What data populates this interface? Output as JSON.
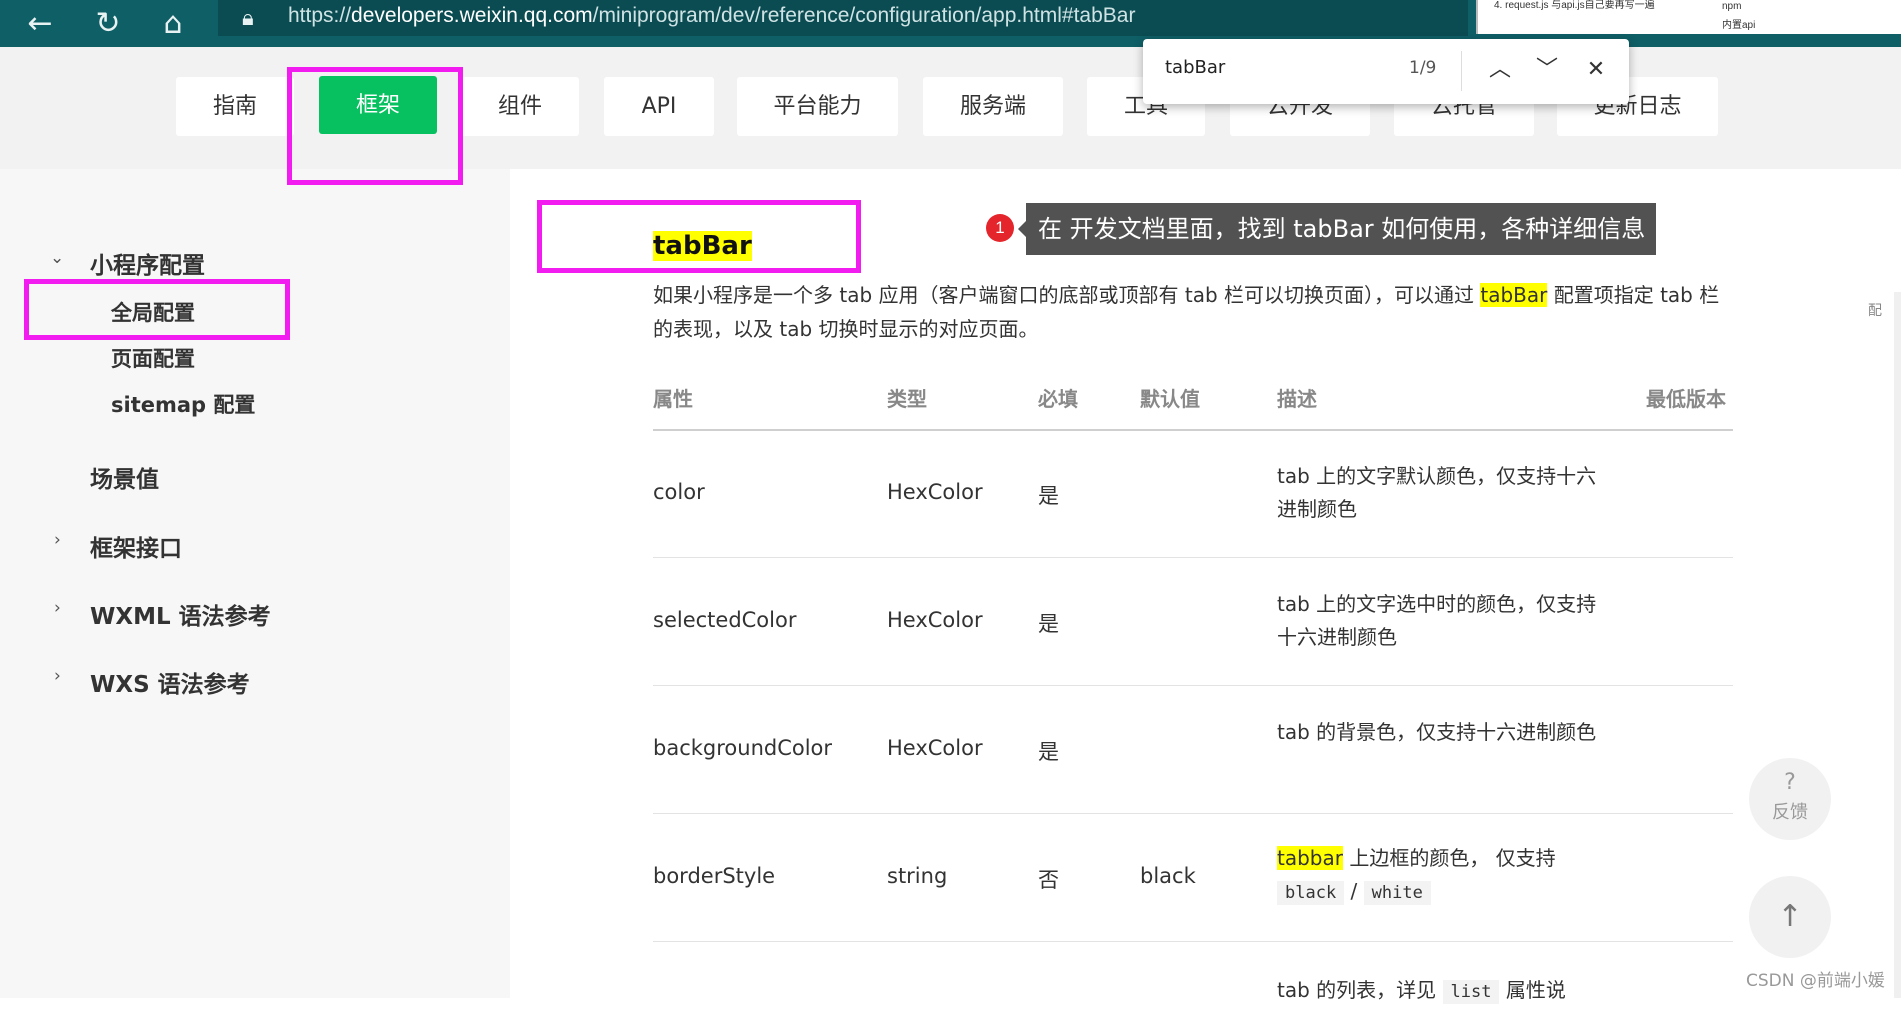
{
  "browser": {
    "url_prefix": "https://",
    "url_domain": "developers.weixin.qq.com",
    "url_path": "/miniprogram/dev/reference/configuration/app.html#tabBar",
    "thumb_line1": "4. request.js 与api.js自己要再写一遍",
    "thumb_line2": "npm",
    "thumb_line3": "内置api"
  },
  "top_menu": [
    {
      "label": "指南"
    },
    {
      "label": "框架"
    },
    {
      "label": "组件"
    },
    {
      "label": "API"
    },
    {
      "label": "平台能力"
    },
    {
      "label": "服务端"
    },
    {
      "label": "工具"
    },
    {
      "label": "云开发"
    },
    {
      "label": "云托管"
    },
    {
      "label": "更新日志"
    }
  ],
  "find": {
    "query": "tabBar",
    "count": "1/9"
  },
  "sidebar": {
    "section1": "小程序配置",
    "sub1": "全局配置",
    "sub2": "页面配置",
    "sub3": "sitemap 配置",
    "item2": "场景值",
    "item3": "框架接口",
    "item4": "WXML 语法参考",
    "item5": "WXS 语法参考"
  },
  "content": {
    "title": "tabBar",
    "desc_part1": "如果小程序是一个多 tab 应用（客户端窗口的底部或顶部有 tab 栏可以切换页面），可以通过 ",
    "desc_highlight": "tabBar",
    "desc_part2": " 配置项指定 tab 栏的表现，以及 tab 切换时显示的对应页面。",
    "annotation_num": "1",
    "annotation_text": "在 开发文档里面，找到 tabBar 如何使用，各种详细信息"
  },
  "table": {
    "headers": [
      "属性",
      "类型",
      "必填",
      "默认值",
      "描述",
      "最低版本"
    ],
    "rows": [
      {
        "attr": "color",
        "type": "HexColor",
        "required": "是",
        "default": "",
        "desc": "tab 上的文字默认颜色，仅支持十六进制颜色"
      },
      {
        "attr": "selectedColor",
        "type": "HexColor",
        "required": "是",
        "default": "",
        "desc": "tab 上的文字选中时的颜色，仅支持十六进制颜色"
      },
      {
        "attr": "backgroundColor",
        "type": "HexColor",
        "required": "是",
        "default": "",
        "desc": "tab 的背景色，仅支持十六进制颜色"
      },
      {
        "attr": "borderStyle",
        "type": "string",
        "required": "否",
        "default": "black",
        "desc_highlight": "tabbar",
        "desc_rest": " 上边框的颜色， 仅支持",
        "code1": "black",
        "slash": "/",
        "code2": "white"
      }
    ],
    "partial_row": {
      "text1": "tab 的列表，详见",
      "code": "list",
      "text2": "属性说"
    }
  },
  "right_panel": {
    "mini_char": "配",
    "feedback_q": "?",
    "feedback_label": "反馈",
    "totop": "↑"
  },
  "watermark": "CSDN @前端小媛"
}
